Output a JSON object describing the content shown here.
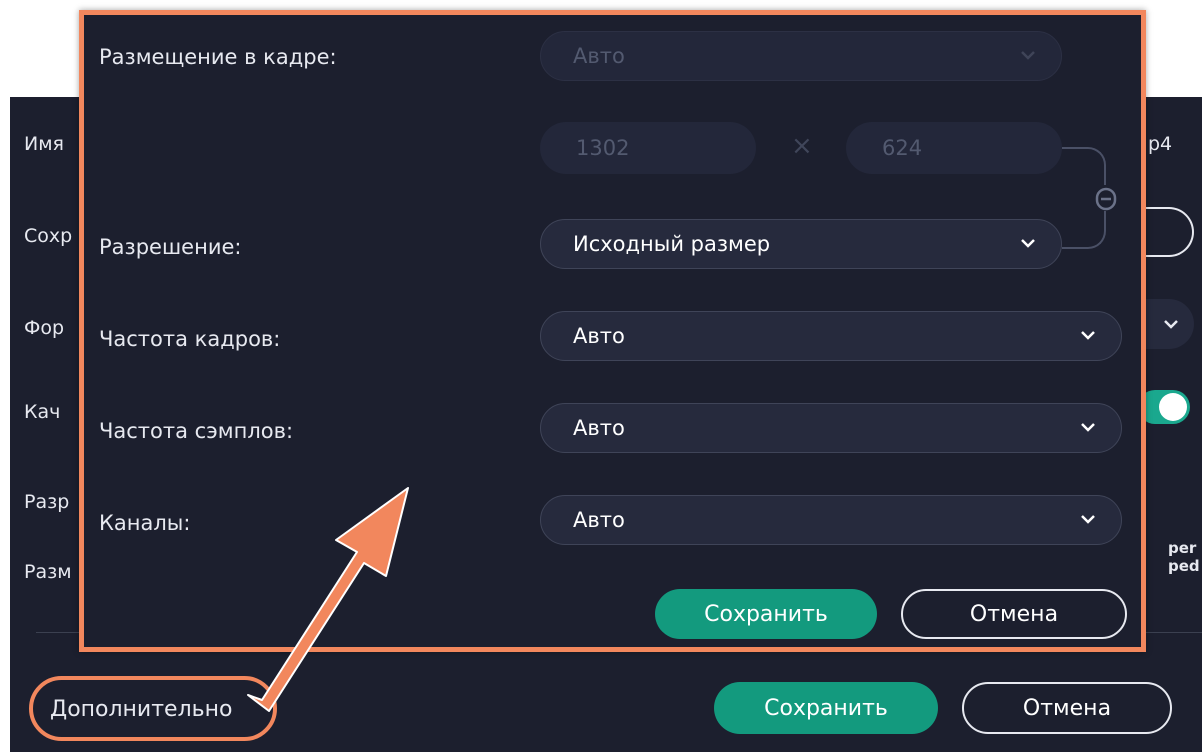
{
  "background_dialog": {
    "labels": {
      "name": "Имя",
      "save_to": "Сохр",
      "format": "Фор",
      "quality": "Кач",
      "resolution": "Разр",
      "size": "Разм"
    },
    "filename_ext": "p4",
    "small_text_1": "per",
    "small_text_2": "ped",
    "advanced_link": "Дополнительно",
    "save_button": "Сохранить",
    "cancel_button": "Отмена"
  },
  "advanced_panel": {
    "placement": {
      "label": "Размещение в кадре:",
      "value": "Авто",
      "disabled": true
    },
    "dimensions": {
      "width": "1302",
      "height": "624",
      "separator": "×",
      "disabled": true
    },
    "resolution": {
      "label": "Разрешение:",
      "value": "Исходный размер"
    },
    "frame_rate": {
      "label": "Частота кадров:",
      "value": "Авто"
    },
    "sample_rate": {
      "label": "Частота сэмплов:",
      "value": "Авто"
    },
    "channels": {
      "label": "Каналы:",
      "value": "Авто"
    },
    "save_button": "Сохранить",
    "cancel_button": "Отмена"
  },
  "icons": {
    "chevron": "chevron-down-icon",
    "link": "link-chain-icon"
  },
  "colors": {
    "panel_bg": "#1c1f2e",
    "highlight": "#f2875d",
    "primary_button": "#139a7e",
    "toggle_on": "#1aa88e"
  }
}
